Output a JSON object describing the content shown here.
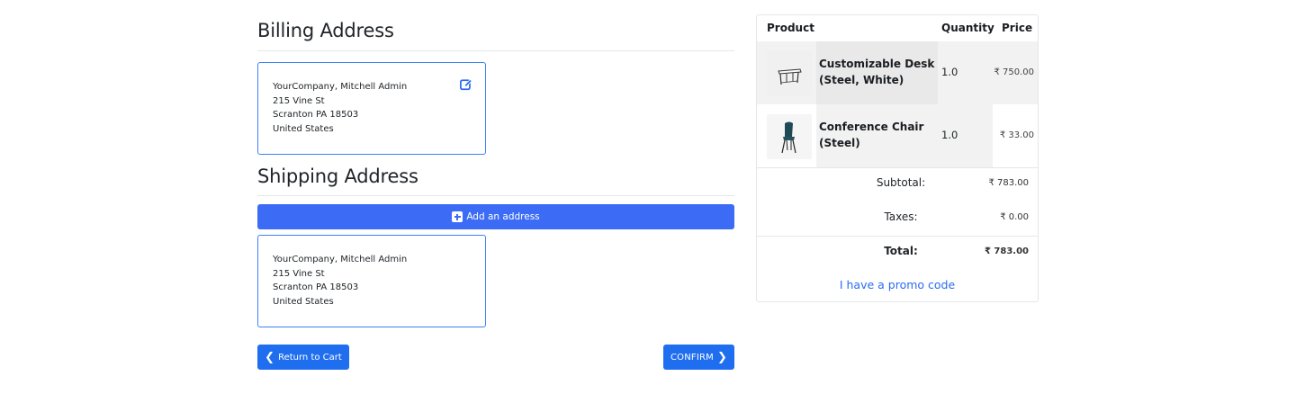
{
  "billing": {
    "title": "Billing Address",
    "address": [
      "YourCompany, Mitchell Admin",
      "215 Vine St",
      "Scranton PA 18503",
      "United States"
    ],
    "edit_icon": "edit-icon"
  },
  "shipping": {
    "title": "Shipping Address",
    "add_label": "Add an address",
    "address": [
      "YourCompany, Mitchell Admin",
      "215 Vine St",
      "Scranton PA 18503",
      "United States"
    ]
  },
  "actions": {
    "return_label": "Return to Cart",
    "confirm_label": "CONFIRM"
  },
  "summary": {
    "headers": {
      "product": "Product",
      "quantity": "Quantity",
      "price": "Price"
    },
    "items": [
      {
        "name": "Customizable Desk (Steel, White)",
        "quantity": "1.0",
        "price": "₹ 750.00"
      },
      {
        "name": "Conference Chair (Steel)",
        "quantity": "1.0",
        "price": "₹ 33.00"
      }
    ],
    "subtotal_label": "Subtotal:",
    "subtotal": "₹ 783.00",
    "taxes_label": "Taxes:",
    "taxes": "₹ 0.00",
    "total_label": "Total:",
    "total": "₹ 783.00",
    "promo_label": "I have a promo code"
  },
  "colors": {
    "accent": "#1f6ef0",
    "card_border": "#3b82f6",
    "link": "#2b6cf0"
  }
}
